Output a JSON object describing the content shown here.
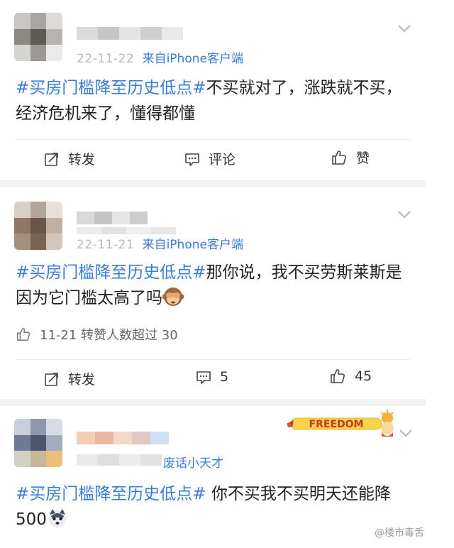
{
  "posts": [
    {
      "time": "22-11-22",
      "source": "来自iPhone客户端",
      "topic": "#买房门槛降至历史低点#",
      "text": "不买就对了，涨跌就不买，经济危机来了，懂得都懂",
      "actions": {
        "repost": "转发",
        "comment": "评论",
        "like": "赞"
      }
    },
    {
      "time": "22-11-21",
      "source": "来自iPhone客户端",
      "topic": "#买房门槛降至历史低点#",
      "text": "那你说，我不买劳斯莱斯是因为它门槛太高了吗",
      "emoji": "see-no-evil-monkey-icon",
      "liked_text": "11-21 转赞人数超过 30",
      "actions": {
        "repost": "转发",
        "comment": "5",
        "like": "45"
      }
    },
    {
      "source": "废话小天才",
      "badge": "FREEDOM",
      "topic": "#买房门槛降至历史低点#",
      "text": " 你不买我不买明天还能降 500",
      "emoji": "husky-face-icon"
    }
  ],
  "watermark": "@楼市毒舌",
  "colors": {
    "topic": "#3a7bd5",
    "separator": "#f2f2f2",
    "badge_bg": "#f7d44c",
    "badge_text": "#c0392b"
  }
}
